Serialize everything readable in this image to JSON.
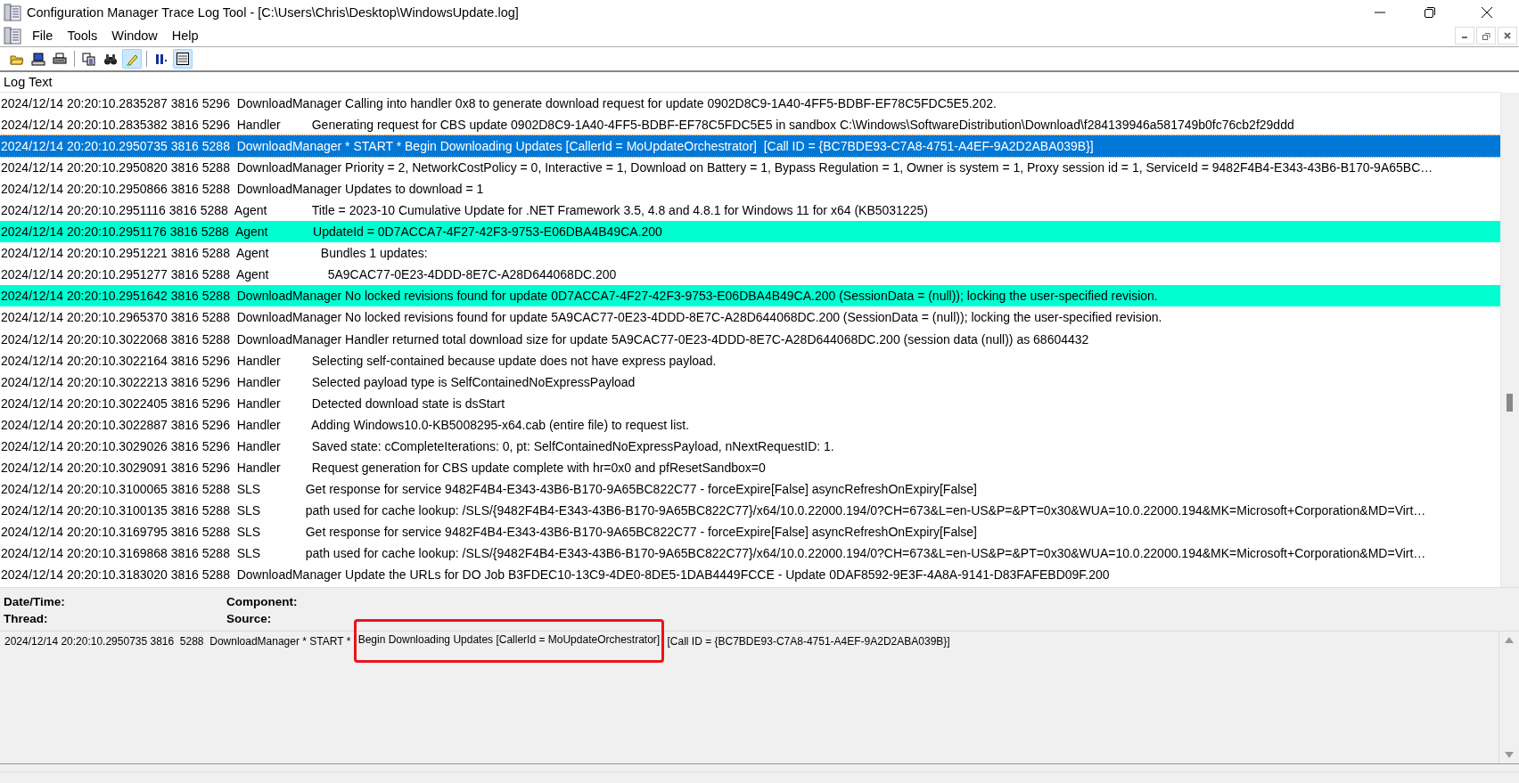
{
  "window": {
    "title": "Configuration Manager Trace Log Tool - [C:\\Users\\Chris\\Desktop\\WindowsUpdate.log]"
  },
  "menu": [
    "File",
    "Tools",
    "Window",
    "Help"
  ],
  "toolbar": [
    {
      "kind": "open",
      "on": false
    },
    {
      "kind": "computer",
      "on": false
    },
    {
      "kind": "print",
      "on": false
    },
    {
      "kind": "copy",
      "on": false
    },
    {
      "kind": "find",
      "on": false
    },
    {
      "kind": "highlight",
      "on": true
    },
    {
      "kind": "pause",
      "on": false
    },
    {
      "kind": "window",
      "on": true
    }
  ],
  "log": {
    "header": "Log Text",
    "rows": [
      {
        "text": "2024/12/14 20:20:10.2835287 3816 5296  DownloadManager Calling into handler 0x8 to generate download request for update 0902D8C9-1A40-4FF5-BDBF-EF78C5FDC5E5.202.",
        "selected": false,
        "highlighted": false
      },
      {
        "text": "2024/12/14 20:20:10.2835382 3816 5296  Handler         Generating request for CBS update 0902D8C9-1A40-4FF5-BDBF-EF78C5FDC5E5 in sandbox C:\\Windows\\SoftwareDistribution\\Download\\f284139946a581749b0fc76cb2f29ddd",
        "selected": false,
        "highlighted": false
      },
      {
        "text": "2024/12/14 20:20:10.2950735 3816 5288  DownloadManager * START * Begin Downloading Updates [CallerId = MoUpdateOrchestrator]  [Call ID = {BC7BDE93-C7A8-4751-A4EF-9A2D2ABA039B}]",
        "selected": true,
        "highlighted": false
      },
      {
        "text": "2024/12/14 20:20:10.2950820 3816 5288  DownloadManager Priority = 2, NetworkCostPolicy = 0, Interactive = 1, Download on Battery = 1, Bypass Regulation = 1, Owner is system = 1, Proxy session id = 1, ServiceId = 9482F4B4-E343-43B6-B170-9A65BC…",
        "selected": false,
        "highlighted": false
      },
      {
        "text": "2024/12/14 20:20:10.2950866 3816 5288  DownloadManager Updates to download = 1",
        "selected": false,
        "highlighted": false
      },
      {
        "text": "2024/12/14 20:20:10.2951116 3816 5288  Agent             Title = 2023-10 Cumulative Update for .NET Framework 3.5, 4.8 and 4.8.1 for Windows 11 for x64 (KB5031225)",
        "selected": false,
        "highlighted": false
      },
      {
        "text": "2024/12/14 20:20:10.2951176 3816 5288  Agent             UpdateId = 0D7ACCA7-4F27-42F3-9753-E06DBA4B49CA.200",
        "selected": false,
        "highlighted": true
      },
      {
        "text": "2024/12/14 20:20:10.2951221 3816 5288  Agent               Bundles 1 updates:",
        "selected": false,
        "highlighted": false
      },
      {
        "text": "2024/12/14 20:20:10.2951277 3816 5288  Agent                 5A9CAC77-0E23-4DDD-8E7C-A28D644068DC.200",
        "selected": false,
        "highlighted": false
      },
      {
        "text": "2024/12/14 20:20:10.2951642 3816 5288  DownloadManager No locked revisions found for update 0D7ACCA7-4F27-42F3-9753-E06DBA4B49CA.200 (SessionData = (null)); locking the user-specified revision.",
        "selected": false,
        "highlighted": true
      },
      {
        "text": "2024/12/14 20:20:10.2965370 3816 5288  DownloadManager No locked revisions found for update 5A9CAC77-0E23-4DDD-8E7C-A28D644068DC.200 (SessionData = (null)); locking the user-specified revision.",
        "selected": false,
        "highlighted": false
      },
      {
        "text": "2024/12/14 20:20:10.3022068 3816 5288  DownloadManager Handler returned total download size for update 5A9CAC77-0E23-4DDD-8E7C-A28D644068DC.200 (session data (null)) as 68604432",
        "selected": false,
        "highlighted": false
      },
      {
        "text": "2024/12/14 20:20:10.3022164 3816 5296  Handler         Selecting self-contained because update does not have express payload.",
        "selected": false,
        "highlighted": false
      },
      {
        "text": "2024/12/14 20:20:10.3022213 3816 5296  Handler         Selected payload type is SelfContainedNoExpressPayload",
        "selected": false,
        "highlighted": false
      },
      {
        "text": "2024/12/14 20:20:10.3022405 3816 5296  Handler         Detected download state is dsStart",
        "selected": false,
        "highlighted": false
      },
      {
        "text": "2024/12/14 20:20:10.3022887 3816 5296  Handler         Adding Windows10.0-KB5008295-x64.cab (entire file) to request list.",
        "selected": false,
        "highlighted": false
      },
      {
        "text": "2024/12/14 20:20:10.3029026 3816 5296  Handler         Saved state: cCompleteIterations: 0, pt: SelfContainedNoExpressPayload, nNextRequestID: 1.",
        "selected": false,
        "highlighted": false
      },
      {
        "text": "2024/12/14 20:20:10.3029091 3816 5296  Handler         Request generation for CBS update complete with hr=0x0 and pfResetSandbox=0",
        "selected": false,
        "highlighted": false
      },
      {
        "text": "2024/12/14 20:20:10.3100065 3816 5288  SLS             Get response for service 9482F4B4-E343-43B6-B170-9A65BC822C77 - forceExpire[False] asyncRefreshOnExpiry[False]",
        "selected": false,
        "highlighted": false
      },
      {
        "text": "2024/12/14 20:20:10.3100135 3816 5288  SLS             path used for cache lookup: /SLS/{9482F4B4-E343-43B6-B170-9A65BC822C77}/x64/10.0.22000.194/0?CH=673&L=en-US&P=&PT=0x30&WUA=10.0.22000.194&MK=Microsoft+Corporation&MD=Virt…",
        "selected": false,
        "highlighted": false
      },
      {
        "text": "2024/12/14 20:20:10.3169795 3816 5288  SLS             Get response for service 9482F4B4-E343-43B6-B170-9A65BC822C77 - forceExpire[False] asyncRefreshOnExpiry[False]",
        "selected": false,
        "highlighted": false
      },
      {
        "text": "2024/12/14 20:20:10.3169868 3816 5288  SLS             path used for cache lookup: /SLS/{9482F4B4-E343-43B6-B170-9A65BC822C77}/x64/10.0.22000.194/0?CH=673&L=en-US&P=&PT=0x30&WUA=10.0.22000.194&MK=Microsoft+Corporation&MD=Virt…",
        "selected": false,
        "highlighted": false
      },
      {
        "text": "2024/12/14 20:20:10.3183020 3816 5288  DownloadManager Update the URLs for DO Job B3FDEC10-13C9-4DE0-8DE5-1DAB4449FCCE - Update 0DAF8592-9E3F-4A8A-9141-D83FAFEBD09F.200",
        "selected": false,
        "highlighted": false
      }
    ]
  },
  "details": {
    "fields": [
      "Date/Time:",
      "Component:",
      "Thread:",
      "Source:"
    ],
    "message_before": "2024/12/14 20:20:10.2950735 3816  5288  DownloadManager * START *",
    "message_marked": "Begin Downloading Updates [CallerId = MoUpdateOrchestrator]",
    "message_after": "[Call ID = {BC7BDE93-C7A8-4751-A4EF-9A2D2ABA039B}]"
  }
}
